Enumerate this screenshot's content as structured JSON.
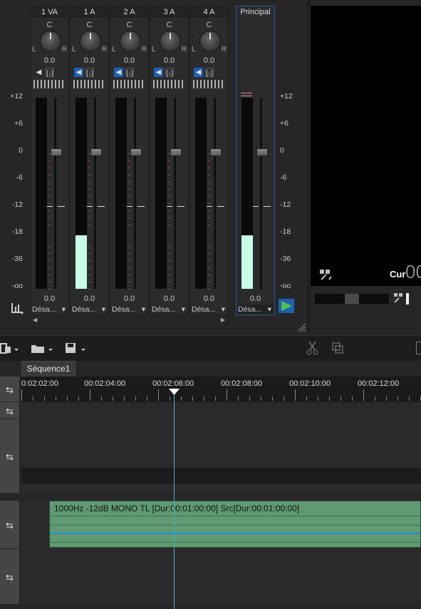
{
  "mixer": {
    "channels": [
      {
        "name": "1 VA",
        "pan_center": "C",
        "pan_left": "L",
        "pan_right": "R",
        "pan_value": "0.0",
        "fader_value": "0.0",
        "output": "Désa...",
        "mute_on": false,
        "level": 0
      },
      {
        "name": "1 A",
        "pan_center": "C",
        "pan_left": "L",
        "pan_right": "R",
        "pan_value": "0.0",
        "fader_value": "0.0",
        "output": "Désa...",
        "mute_on": true,
        "level": 0.28
      },
      {
        "name": "2 A",
        "pan_center": "C",
        "pan_left": "L",
        "pan_right": "R",
        "pan_value": "0.0",
        "fader_value": "0.0",
        "output": "Désa...",
        "mute_on": true,
        "level": 0
      },
      {
        "name": "3 A",
        "pan_center": "C",
        "pan_left": "L",
        "pan_right": "R",
        "pan_value": "0.0",
        "fader_value": "0.0",
        "output": "Désa...",
        "mute_on": true,
        "level": 0
      },
      {
        "name": "4 A",
        "pan_center": "C",
        "pan_left": "L",
        "pan_right": "R",
        "pan_value": "0.0",
        "fader_value": "0.0",
        "output": "Désa...",
        "mute_on": true,
        "level": 0
      }
    ],
    "master": {
      "name": "Principal",
      "fader_value": "0.0",
      "output": "Désa...",
      "level": 0.28
    },
    "scale": [
      "+12",
      "+6",
      "0",
      "-6",
      "-12",
      "-18",
      "-36",
      "-oo"
    ],
    "mute_glyph": "◀",
    "solo_glyph": "[↓]",
    "dropdown_glyph": "▾"
  },
  "preview": {
    "cur_label": "Cur",
    "cur_value_partial": "00"
  },
  "timeline": {
    "sequence_tab": "Séquence1",
    "ruler": [
      "0:02:02:00",
      "00:02:04:00",
      "00:02:06:00",
      "00:02:08:00",
      "00:02:10:00",
      "00:02:12:00"
    ],
    "clip_label": "1000Hz -12dB MONO  TL [Dur:00:01:00:00]  Src[Dur:00:01:00:00]",
    "track_swap_glyph": "⇆"
  },
  "colors": {
    "accent_blue": "#1f5fb4",
    "meter_green": "#c8ffe8",
    "clip_green": "#5f9a72",
    "playhead": "#3ab6c8"
  }
}
